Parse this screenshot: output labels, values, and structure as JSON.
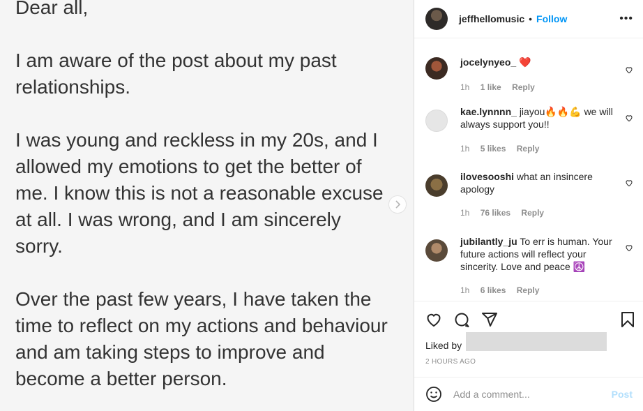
{
  "post": {
    "paragraphs": [
      "Dear all,",
      "I am aware of the post about my past relationships.",
      "I was young and reckless in my 20s, and I allowed my emotions to get the better of me. I know this is not a reasonable excuse at all. I was wrong, and I am sincerely sorry.",
      "Over the past few years, I have taken the time to reflect on my actions and behaviour and am taking steps to improve and become a better person."
    ]
  },
  "header": {
    "username": "jeffhellomusic",
    "separator": "•",
    "follow_label": "Follow",
    "more_label": "•••"
  },
  "comments": [
    {
      "username": "jocelynyeo_",
      "text": "❤️",
      "time": "1h",
      "likes": "1 like",
      "reply": "Reply"
    },
    {
      "username": "kae.lynnnn_",
      "text": "jiayou🔥🔥💪 we will always support you!!",
      "time": "1h",
      "likes": "5 likes",
      "reply": "Reply"
    },
    {
      "username": "ilovesooshi",
      "text": "what an insincere apology",
      "time": "1h",
      "likes": "76 likes",
      "reply": "Reply"
    },
    {
      "username": "jubilantly_ju",
      "text": "To err is human. Your future actions will reflect your sincerity. Love and peace ☮️",
      "time": "1h",
      "likes": "6 likes",
      "reply": "Reply"
    }
  ],
  "actions": {
    "liked_by_label": "Liked by",
    "time_ago": "2 HOURS AGO"
  },
  "add_comment": {
    "placeholder": "Add a comment...",
    "post_label": "Post"
  },
  "colors": {
    "accent": "#0095f6",
    "muted": "#8e8e8e",
    "post_disabled": "#b2dffc"
  }
}
